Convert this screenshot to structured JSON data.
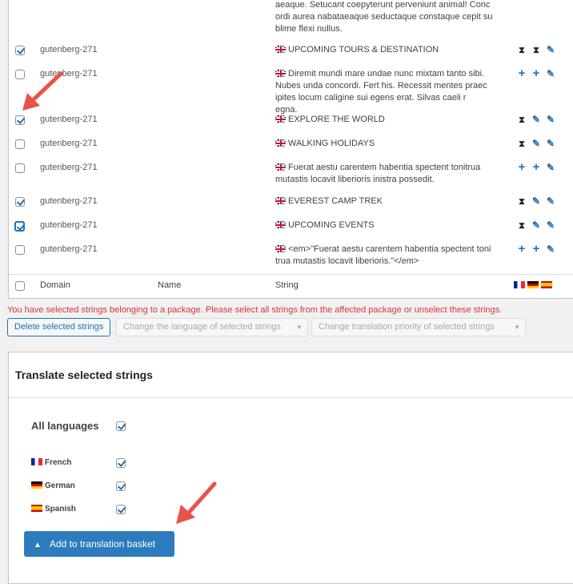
{
  "table": {
    "top_fragment": [
      "aeaque. Setucant coepyterunt perveniunt animal! Conc",
      "ordi aurea nabataeaque seductaque constaque cepit su",
      "blime flexi nullus."
    ],
    "rows": [
      {
        "checked": true,
        "domain": "gutenberg-271",
        "string": "UPCOMING TOURS & DESTINATION",
        "actions": [
          "hourglass",
          "hourglass",
          "pencil"
        ]
      },
      {
        "checked": false,
        "domain": "gutenberg-271",
        "string": "Diremit mundi mare undae nunc mixtam tanto sibi. Nubes unda concordi. Fert his. Recessit mentes praecipites locum caligine sui egens erat. Silvas caeli regna.",
        "actions": [
          "plus",
          "plus",
          "pencil"
        ]
      },
      {
        "checked": true,
        "domain": "gutenberg-271",
        "string": "EXPLORE THE WORLD",
        "actions": [
          "hourglass",
          "pencil",
          "pencil"
        ]
      },
      {
        "checked": false,
        "domain": "gutenberg-271",
        "string": "WALKING HOLIDAYS",
        "actions": [
          "hourglass",
          "pencil",
          "pencil"
        ]
      },
      {
        "checked": false,
        "domain": "gutenberg-271",
        "string": "Fuerat aestu carentem habentia spectent tonitrua mutastis locavit liberioris inistra possedit.",
        "actions": [
          "plus",
          "plus",
          "pencil"
        ]
      },
      {
        "checked": true,
        "domain": "gutenberg-271",
        "string": "EVEREST CAMP TREK",
        "actions": [
          "hourglass",
          "pencil",
          "pencil"
        ]
      },
      {
        "checked": true,
        "focused": true,
        "domain": "gutenberg-271",
        "string": "UPCOMING EVENTS",
        "actions": [
          "hourglass",
          "pencil",
          "pencil"
        ]
      },
      {
        "checked": false,
        "domain": "gutenberg-271",
        "string": "<em>\"Fuerat aestu carentem habentia spectent tonitrua mutastis locavit liberioris.\"</em>",
        "actions": [
          "plus",
          "plus",
          "pencil"
        ]
      }
    ],
    "footer": {
      "domain": "Domain",
      "name": "Name",
      "string": "String",
      "flags": [
        "flag-fr",
        "flag-de",
        "flag-es"
      ]
    }
  },
  "warning": "You have selected strings belonging to a package. Please select all strings from the affected package or unselect these strings.",
  "bulk": {
    "delete_label": "Delete selected strings",
    "language_select": "Change the language of selected strings",
    "priority_select": "Change translation priority of selected strings"
  },
  "translate": {
    "title": "Translate selected strings",
    "all_languages": "All languages",
    "all_checked": true,
    "languages": [
      {
        "name": "French",
        "flag": "flag-fr",
        "checked": true
      },
      {
        "name": "German",
        "flag": "flag-de",
        "checked": true
      },
      {
        "name": "Spanish",
        "flag": "flag-es",
        "checked": true
      }
    ],
    "button_label": "Add to translation basket"
  },
  "icons": {
    "hourglass": "⧗",
    "plus": "+",
    "pencil": "✎",
    "basket": "🧺"
  },
  "accent_color": "#2271b1",
  "annotation_color": "#e8534a"
}
